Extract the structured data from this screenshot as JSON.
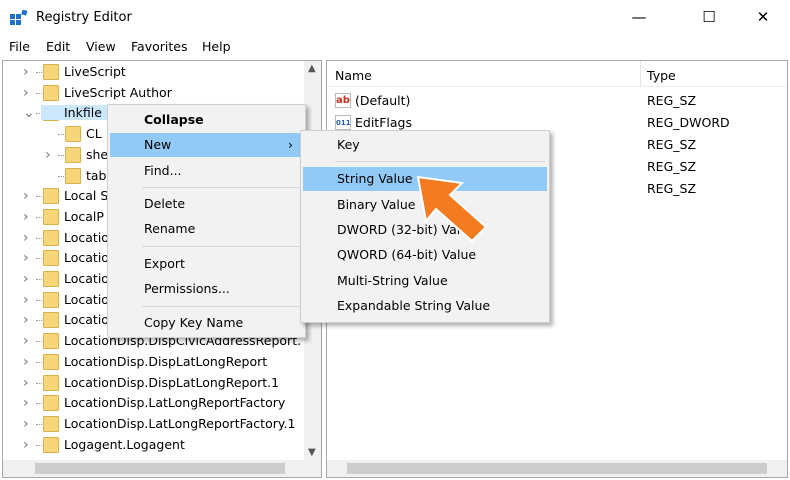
{
  "window": {
    "title": "Registry Editor",
    "minimize": "—",
    "maximize": "☐",
    "close": "✕"
  },
  "menubar": [
    "File",
    "Edit",
    "View",
    "Favorites",
    "Help"
  ],
  "tree": [
    {
      "label": "LiveScript",
      "state": "collapsed",
      "indent": 0
    },
    {
      "label": "LiveScript Author",
      "state": "collapsed",
      "indent": 0
    },
    {
      "label": "Inkfile",
      "state": "expanded",
      "indent": 0,
      "selected": true
    },
    {
      "label": "CL",
      "state": "leaf",
      "indent": 1
    },
    {
      "label": "she",
      "state": "collapsed",
      "indent": 1
    },
    {
      "label": "tab",
      "state": "leaf",
      "indent": 1
    },
    {
      "label": "Local S",
      "state": "collapsed",
      "indent": 0
    },
    {
      "label": "LocalP",
      "state": "collapsed",
      "indent": 0
    },
    {
      "label": "Locatio",
      "state": "collapsed",
      "indent": 0
    },
    {
      "label": "Locatio",
      "state": "collapsed",
      "indent": 0
    },
    {
      "label": "Locatio",
      "state": "collapsed",
      "indent": 0
    },
    {
      "label": "Locatio",
      "state": "collapsed",
      "indent": 0
    },
    {
      "label": "Locatio",
      "state": "collapsed",
      "indent": 0
    },
    {
      "label": "LocationDisp.DispCivicAddressReport.",
      "state": "collapsed",
      "indent": 0
    },
    {
      "label": "LocationDisp.DispLatLongReport",
      "state": "collapsed",
      "indent": 0
    },
    {
      "label": "LocationDisp.DispLatLongReport.1",
      "state": "collapsed",
      "indent": 0
    },
    {
      "label": "LocationDisp.LatLongReportFactory",
      "state": "collapsed",
      "indent": 0
    },
    {
      "label": "LocationDisp.LatLongReportFactory.1",
      "state": "collapsed",
      "indent": 0
    },
    {
      "label": "Logagent.Logagent",
      "state": "collapsed",
      "indent": 0
    }
  ],
  "values": {
    "headers": {
      "name": "Name",
      "type": "Type"
    },
    "rows": [
      {
        "name": "(Default)",
        "type": "REG_SZ",
        "icon": "string-icon",
        "glyph": "ab"
      },
      {
        "name": "EditFlags",
        "type": "REG_DWORD",
        "icon": "binary-icon",
        "glyph": "011"
      },
      {
        "name": "",
        "type": "REG_SZ"
      },
      {
        "name": "",
        "type": "REG_SZ"
      },
      {
        "name": "",
        "type": "REG_SZ"
      }
    ]
  },
  "context_menu": {
    "items": [
      "Collapse",
      "New",
      "Find...",
      "Delete",
      "Rename",
      "Export",
      "Permissions...",
      "Copy Key Name"
    ],
    "submenu_arrow": "›"
  },
  "new_submenu": {
    "items": [
      "Key",
      "String Value",
      "Binary Value",
      "DWORD (32-bit) Value",
      "QWORD (64-bit) Value",
      "Multi-String Value",
      "Expandable String Value"
    ],
    "highlighted": "String Value"
  },
  "colors": {
    "highlight": "#91c9f7",
    "selected": "#cce8ff",
    "arrow": "#f47b20"
  }
}
